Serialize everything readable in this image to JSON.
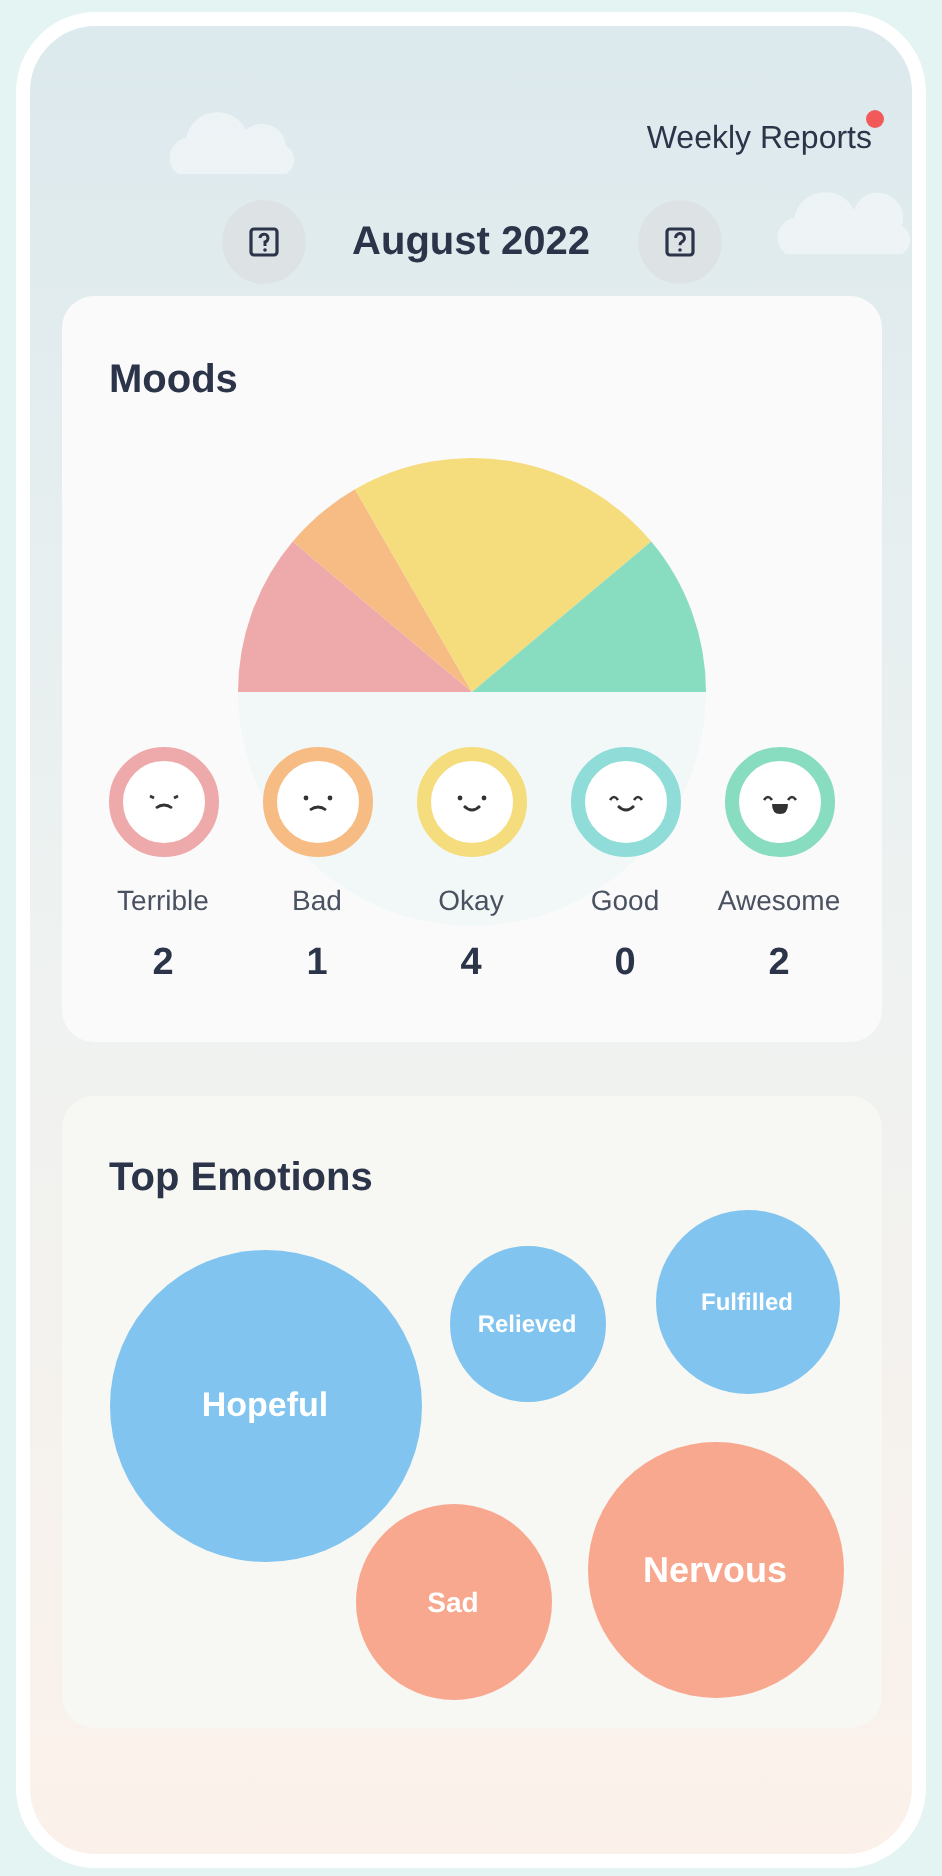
{
  "header": {
    "link": "Weekly Reports",
    "notification": true,
    "month": "August 2022"
  },
  "moods": {
    "title": "Moods",
    "items": [
      {
        "label": "Terrible",
        "count": "2",
        "color": "#eeaaaa",
        "kind": "terrible"
      },
      {
        "label": "Bad",
        "count": "1",
        "color": "#f6bc84",
        "kind": "bad"
      },
      {
        "label": "Okay",
        "count": "4",
        "color": "#f5dc7c",
        "kind": "okay"
      },
      {
        "label": "Good",
        "count": "0",
        "color": "#8fdcd8",
        "kind": "good"
      },
      {
        "label": "Awesome",
        "count": "2",
        "color": "#88dcc0",
        "kind": "awesome"
      }
    ]
  },
  "emotions": {
    "title": "Top Emotions",
    "bubbles": [
      {
        "label": "Hopeful",
        "color": "#80c4ef"
      },
      {
        "label": "Relieved",
        "color": "#80c4ef"
      },
      {
        "label": "Fulfilled",
        "color": "#80c4ef"
      },
      {
        "label": "Sad",
        "color": "#f8a88e"
      },
      {
        "label": "Nervous",
        "color": "#f8a88e"
      }
    ]
  }
}
